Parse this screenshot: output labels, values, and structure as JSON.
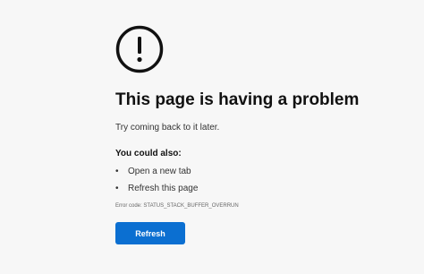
{
  "error": {
    "icon": "exclamation-circle-icon",
    "title": "This page is having a problem",
    "message": "Try coming back to it later.",
    "also_heading": "You could also:",
    "suggestions": [
      {
        "label": "Open a new tab"
      },
      {
        "label": "Refresh this page"
      }
    ],
    "error_code": "Error code: STATUS_STACK_BUFFER_OVERRUN",
    "refresh_label": "Refresh"
  },
  "colors": {
    "background": "#f7f7f7",
    "accent": "#0b6fd1",
    "text": "#1a1a1a"
  }
}
